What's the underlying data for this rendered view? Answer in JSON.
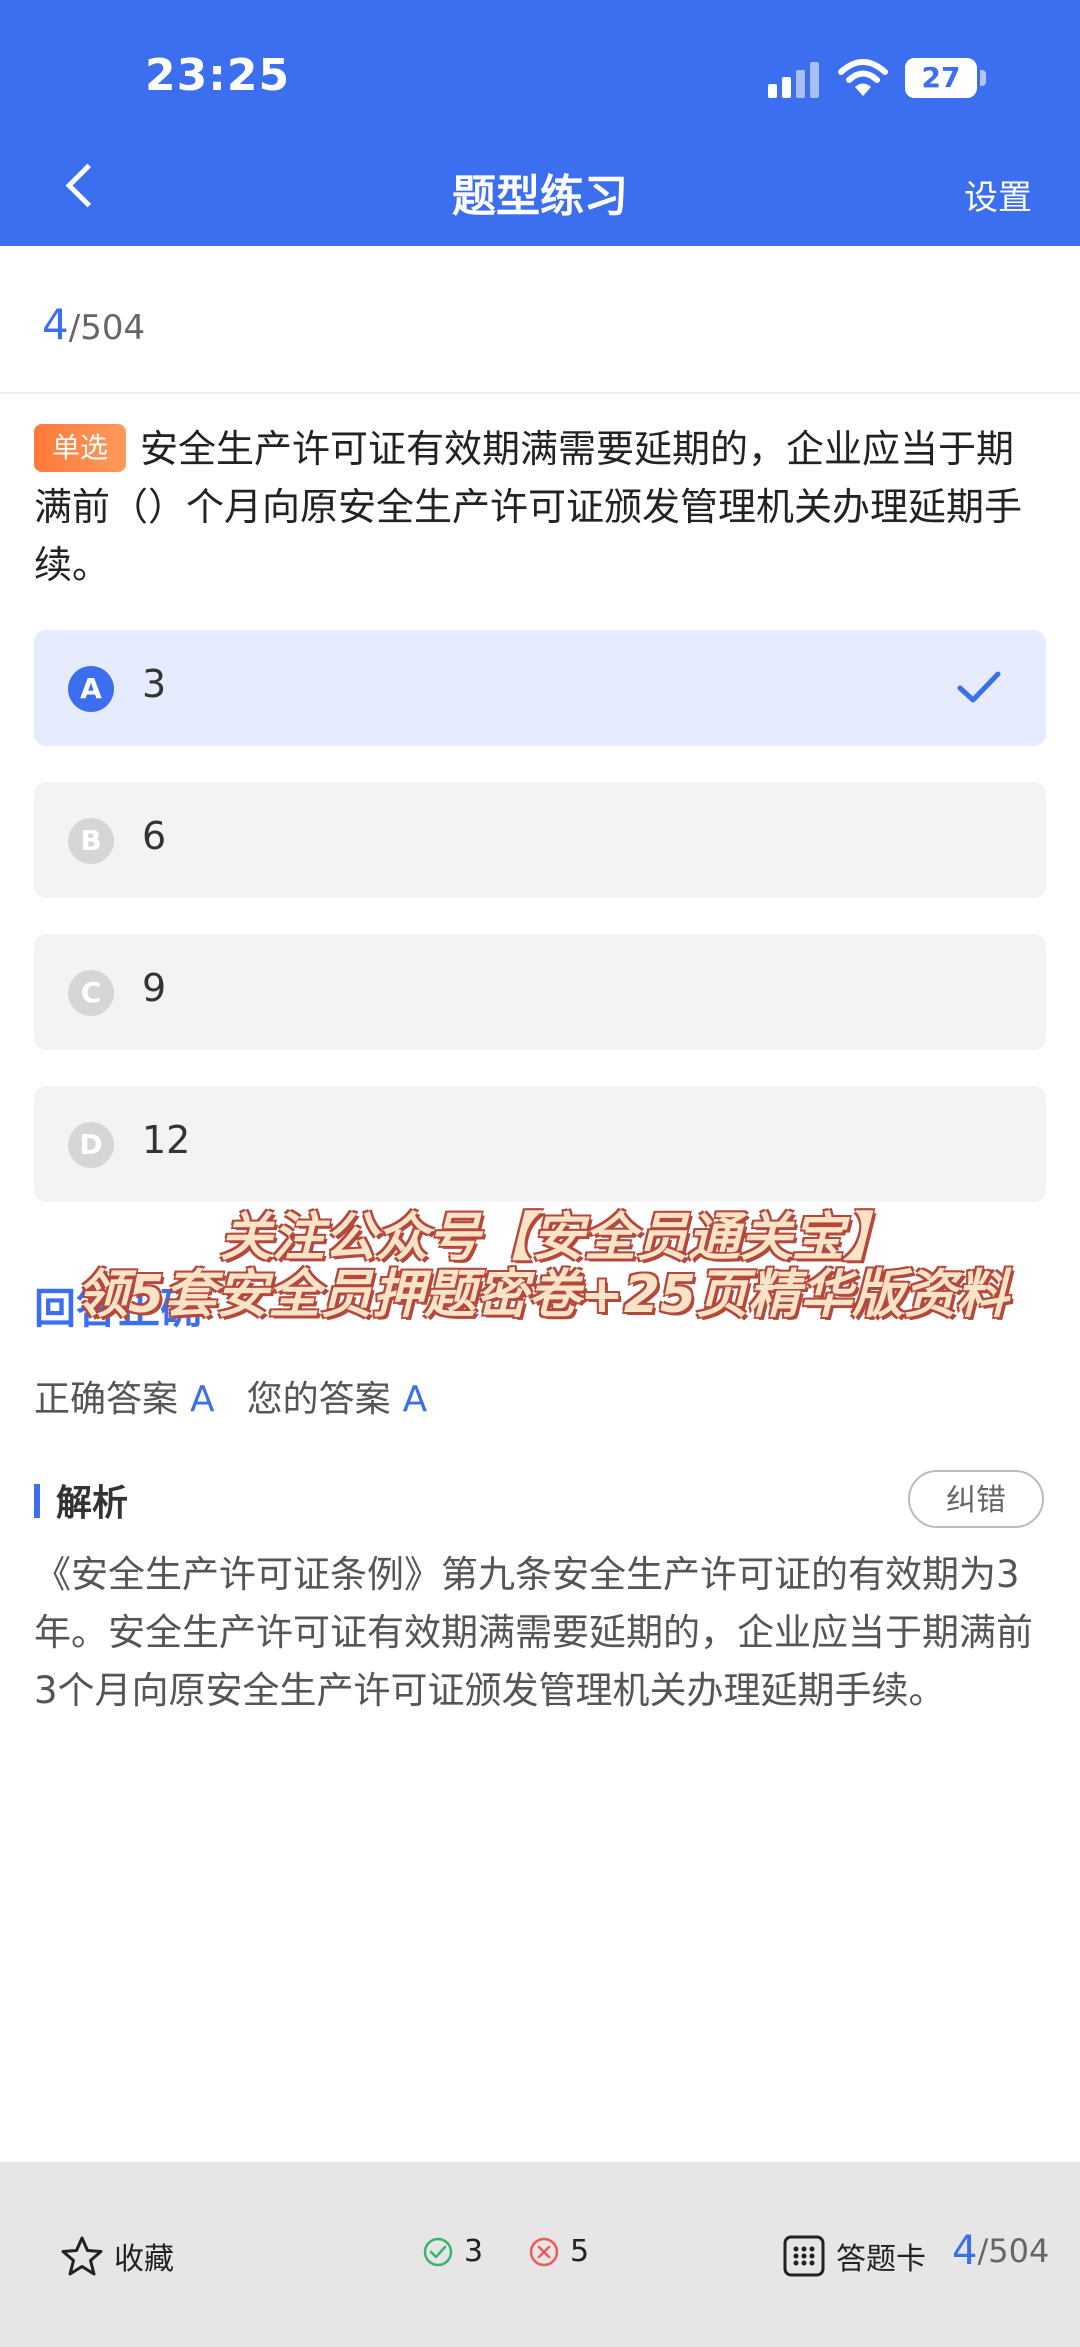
{
  "status_bar": {
    "time": "23:25",
    "battery": "27",
    "battery_level": 0.27
  },
  "header": {
    "title": "题型练习",
    "settings_label": "设置"
  },
  "progress": {
    "current": "4",
    "total": "/504"
  },
  "question": {
    "type_tag": "单选",
    "text": "安全生产许可证有效期满需要延期的，企业应当于期满前（）个月向原安全生产许可证颁发管理机关办理延期手续。"
  },
  "options": [
    {
      "letter": "A",
      "text": "3",
      "selected": true
    },
    {
      "letter": "B",
      "text": "6",
      "selected": false
    },
    {
      "letter": "C",
      "text": "9",
      "selected": false
    },
    {
      "letter": "D",
      "text": "12",
      "selected": false
    }
  ],
  "watermark": {
    "line1": "关注公众号【安全员通关宝】",
    "line2": "领5套安全员押题密卷+25页精华版资料"
  },
  "result": {
    "title": "回答正确",
    "correct_label": "正确答案",
    "correct_answer": "A",
    "your_label": "您的答案",
    "your_answer": "A"
  },
  "analysis": {
    "title": "解析",
    "report_label": "纠错",
    "text": "《安全生产许可证条例》第九条安全生产许可证的有效期为3年。安全生产许可证有效期满需要延期的，企业应当于期满前3个月向原安全生产许可证颁发管理机关办理延期手续。"
  },
  "bottom_bar": {
    "favorite_label": "收藏",
    "correct_count": "3",
    "wrong_count": "5",
    "answer_card_label": "答题卡",
    "progress_current": "4",
    "progress_total": "/504"
  },
  "colors": {
    "accent": "#3c6ff0",
    "tag": "#ff7a3a",
    "correct": "#3cb371",
    "wrong": "#ef5b5b"
  }
}
